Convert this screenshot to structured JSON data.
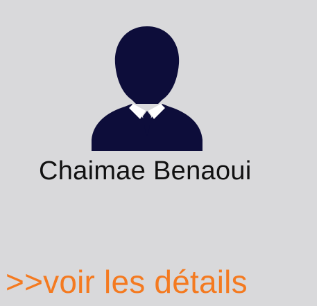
{
  "profile_card": {
    "avatar_icon": "user-silhouette-icon",
    "name": "Chaimae Benaoui",
    "details_link_label": ">>voir les détails"
  },
  "colors": {
    "card_background": "#d9d9db",
    "avatar_fill": "#0d0d3a",
    "name_text": "#111111",
    "link_text": "#f47a20"
  }
}
